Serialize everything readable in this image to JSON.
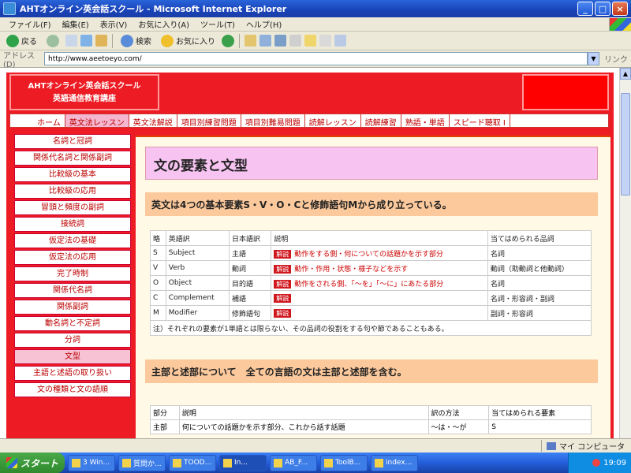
{
  "window": {
    "title": "AHTオンライン英会話スクール - Microsoft Internet Explorer",
    "minimize": "_",
    "maximize": "□",
    "close": "×"
  },
  "menu": [
    "ファイル(F)",
    "編集(E)",
    "表示(V)",
    "お気に入り(A)",
    "ツール(T)",
    "ヘルプ(H)"
  ],
  "toolbar": {
    "back": "戻る",
    "search": "検索",
    "favorites": "お気に入り"
  },
  "address": {
    "label": "アドレス(D)",
    "url": "http://www.aeetoeyo.com/",
    "go": "リンク"
  },
  "site": {
    "logo_line1": "AHTオンライン英会話スクール",
    "logo_line2": "英語通信教育講座",
    "nav": [
      "ホーム",
      "英文法レッスン",
      "英文法解説",
      "項目別練習問題",
      "項目別難易問題",
      "読解レッスン",
      "読解練習",
      "熟語・単語",
      "スピード聴取 I"
    ],
    "sidebar": [
      "名詞と冠詞",
      "関係代名詞と関係副詞",
      "比較級の基本",
      "比較級の応用",
      "冒頭と頻度の副詞",
      "接続詞",
      "仮定法の基礎",
      "仮定法の応用",
      "完了時制",
      "関係代名詞",
      "関係副詞",
      "動名詞と不定詞",
      "分詞",
      "文型",
      "主語と述語の取り扱い",
      "文の種類と文の語順"
    ]
  },
  "content": {
    "heading": "文の要素と文型",
    "intro": "英文は4つの基本要素S・V・O・Cと修飾語句Mから成り立っている。",
    "table_headers": [
      "略",
      "英語訳",
      "日本語訳",
      "説明",
      "当てはめられる品詞"
    ],
    "badge": "解説",
    "rows": [
      {
        "abbr": "S",
        "en": "Subject",
        "ja": "主語",
        "desc": "動作をする側・何についての話題かを示す部分",
        "pos": "名詞"
      },
      {
        "abbr": "V",
        "en": "Verb",
        "ja": "動詞",
        "desc": "動作・作用・状態・様子などを示す",
        "pos": "動詞（助動詞と他動詞）"
      },
      {
        "abbr": "O",
        "en": "Object",
        "ja": "目的語",
        "desc": "動作をされる側、「～を」「～に」にあたる部分",
        "pos": "名詞"
      },
      {
        "abbr": "C",
        "en": "Complement",
        "ja": "補語",
        "desc": "",
        "pos": "名詞・形容詞・副詞"
      },
      {
        "abbr": "M",
        "en": "Modifier",
        "ja": "修飾語句",
        "desc": "",
        "pos": "副詞・形容詞"
      }
    ],
    "note": "注）それぞれの要素が1単語とは限らない、その品詞の役割をする句や節であることもある。",
    "section2": "主部と述部について　全ての言語の文は主部と述部を含む。",
    "table2_headers": [
      "部分",
      "説明",
      "訳の方法",
      "当てはめられる要素"
    ],
    "table2_row": [
      "主部",
      "何についての話題かを示す部分、これから話す話題",
      "～は・～が",
      "S"
    ]
  },
  "status": {
    "text": "",
    "zone": "マイ コンピュータ"
  },
  "taskbar": {
    "start": "スタート",
    "tasks": [
      "3 Win...",
      "質問か...",
      "TOOD...",
      "In...",
      "AB_F...",
      "ToolB...",
      "index..."
    ],
    "clock": "19:09"
  },
  "colors": {
    "site_red": "#ed1c24",
    "heading_pink": "#f7c4f2",
    "section_orange": "#fcc99c",
    "badge_red": "#d0181f"
  }
}
